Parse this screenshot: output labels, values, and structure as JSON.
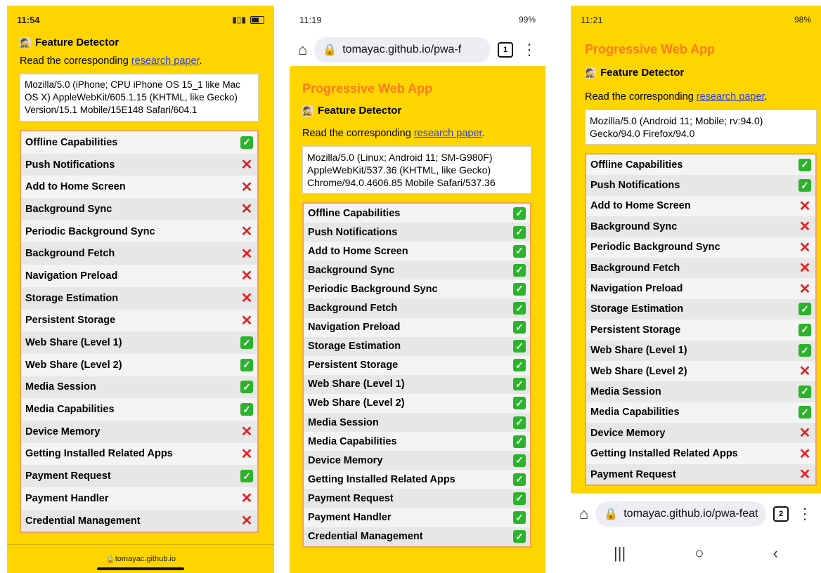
{
  "phones": [
    {
      "status": {
        "time": "11:54",
        "right": "…… 📶 ▮"
      },
      "feature_detector": "Feature Detector",
      "read_prefix": "Read the corresponding ",
      "read_link": "research paper",
      "read_suffix": ".",
      "user_agent": "Mozilla/5.0 (iPhone; CPU iPhone OS 15_1 like Mac OS X) AppleWebKit/605.1.15 (KHTML, like Gecko) Version/15.1 Mobile/15E148 Safari/604.1",
      "features": [
        {
          "label": "Offline Capabilities",
          "ok": true
        },
        {
          "label": "Push Notifications",
          "ok": false
        },
        {
          "label": "Add to Home Screen",
          "ok": false
        },
        {
          "label": "Background Sync",
          "ok": false
        },
        {
          "label": "Periodic Background Sync",
          "ok": false
        },
        {
          "label": "Background Fetch",
          "ok": false
        },
        {
          "label": "Navigation Preload",
          "ok": false
        },
        {
          "label": "Storage Estimation",
          "ok": false
        },
        {
          "label": "Persistent Storage",
          "ok": false
        },
        {
          "label": "Web Share (Level 1)",
          "ok": true
        },
        {
          "label": "Web Share (Level 2)",
          "ok": true
        },
        {
          "label": "Media Session",
          "ok": true
        },
        {
          "label": "Media Capabilities",
          "ok": true
        },
        {
          "label": "Device Memory",
          "ok": false
        },
        {
          "label": "Getting Installed Related Apps",
          "ok": false
        },
        {
          "label": "Payment Request",
          "ok": true
        },
        {
          "label": "Payment Handler",
          "ok": false
        },
        {
          "label": "Credential Management",
          "ok": false
        }
      ],
      "footer_url": "tomayac.github.io"
    },
    {
      "status": {
        "time": "11:19",
        "right": "99%"
      },
      "url": "tomayac.github.io/pwa-f",
      "tabs_count": "1",
      "pwa_heading": "Progressive Web App",
      "feature_detector": "Feature Detector",
      "read_prefix": "Read the corresponding ",
      "read_link": "research paper",
      "read_suffix": ".",
      "user_agent": "Mozilla/5.0 (Linux; Android 11; SM-G980F) AppleWebKit/537.36 (KHTML, like Gecko) Chrome/94.0.4606.85 Mobile Safari/537.36",
      "features": [
        {
          "label": "Offline Capabilities",
          "ok": true
        },
        {
          "label": "Push Notifications",
          "ok": true
        },
        {
          "label": "Add to Home Screen",
          "ok": true
        },
        {
          "label": "Background Sync",
          "ok": true
        },
        {
          "label": "Periodic Background Sync",
          "ok": true
        },
        {
          "label": "Background Fetch",
          "ok": true
        },
        {
          "label": "Navigation Preload",
          "ok": true
        },
        {
          "label": "Storage Estimation",
          "ok": true
        },
        {
          "label": "Persistent Storage",
          "ok": true
        },
        {
          "label": "Web Share (Level 1)",
          "ok": true
        },
        {
          "label": "Web Share (Level 2)",
          "ok": true
        },
        {
          "label": "Media Session",
          "ok": true
        },
        {
          "label": "Media Capabilities",
          "ok": true
        },
        {
          "label": "Device Memory",
          "ok": true
        },
        {
          "label": "Getting Installed Related Apps",
          "ok": true
        },
        {
          "label": "Payment Request",
          "ok": true
        },
        {
          "label": "Payment Handler",
          "ok": true
        },
        {
          "label": "Credential Management",
          "ok": true
        }
      ]
    },
    {
      "status": {
        "time": "11:21",
        "right": "98%"
      },
      "url": "tomayac.github.io/pwa-feat",
      "tabs_count": "2",
      "pwa_heading": "Progressive Web App",
      "feature_detector": "Feature Detector",
      "read_prefix": "Read the corresponding ",
      "read_link": "research paper",
      "read_suffix": ".",
      "user_agent": "Mozilla/5.0 (Android 11; Mobile; rv:94.0) Gecko/94.0 Firefox/94.0",
      "features": [
        {
          "label": "Offline Capabilities",
          "ok": true
        },
        {
          "label": "Push Notifications",
          "ok": true
        },
        {
          "label": "Add to Home Screen",
          "ok": false
        },
        {
          "label": "Background Sync",
          "ok": false
        },
        {
          "label": "Periodic Background Sync",
          "ok": false
        },
        {
          "label": "Background Fetch",
          "ok": false
        },
        {
          "label": "Navigation Preload",
          "ok": false
        },
        {
          "label": "Storage Estimation",
          "ok": true
        },
        {
          "label": "Persistent Storage",
          "ok": true
        },
        {
          "label": "Web Share (Level 1)",
          "ok": true
        },
        {
          "label": "Web Share (Level 2)",
          "ok": false
        },
        {
          "label": "Media Session",
          "ok": true
        },
        {
          "label": "Media Capabilities",
          "ok": true
        },
        {
          "label": "Device Memory",
          "ok": false
        },
        {
          "label": "Getting Installed Related Apps",
          "ok": false
        },
        {
          "label": "Payment Request",
          "ok": false
        }
      ]
    }
  ]
}
